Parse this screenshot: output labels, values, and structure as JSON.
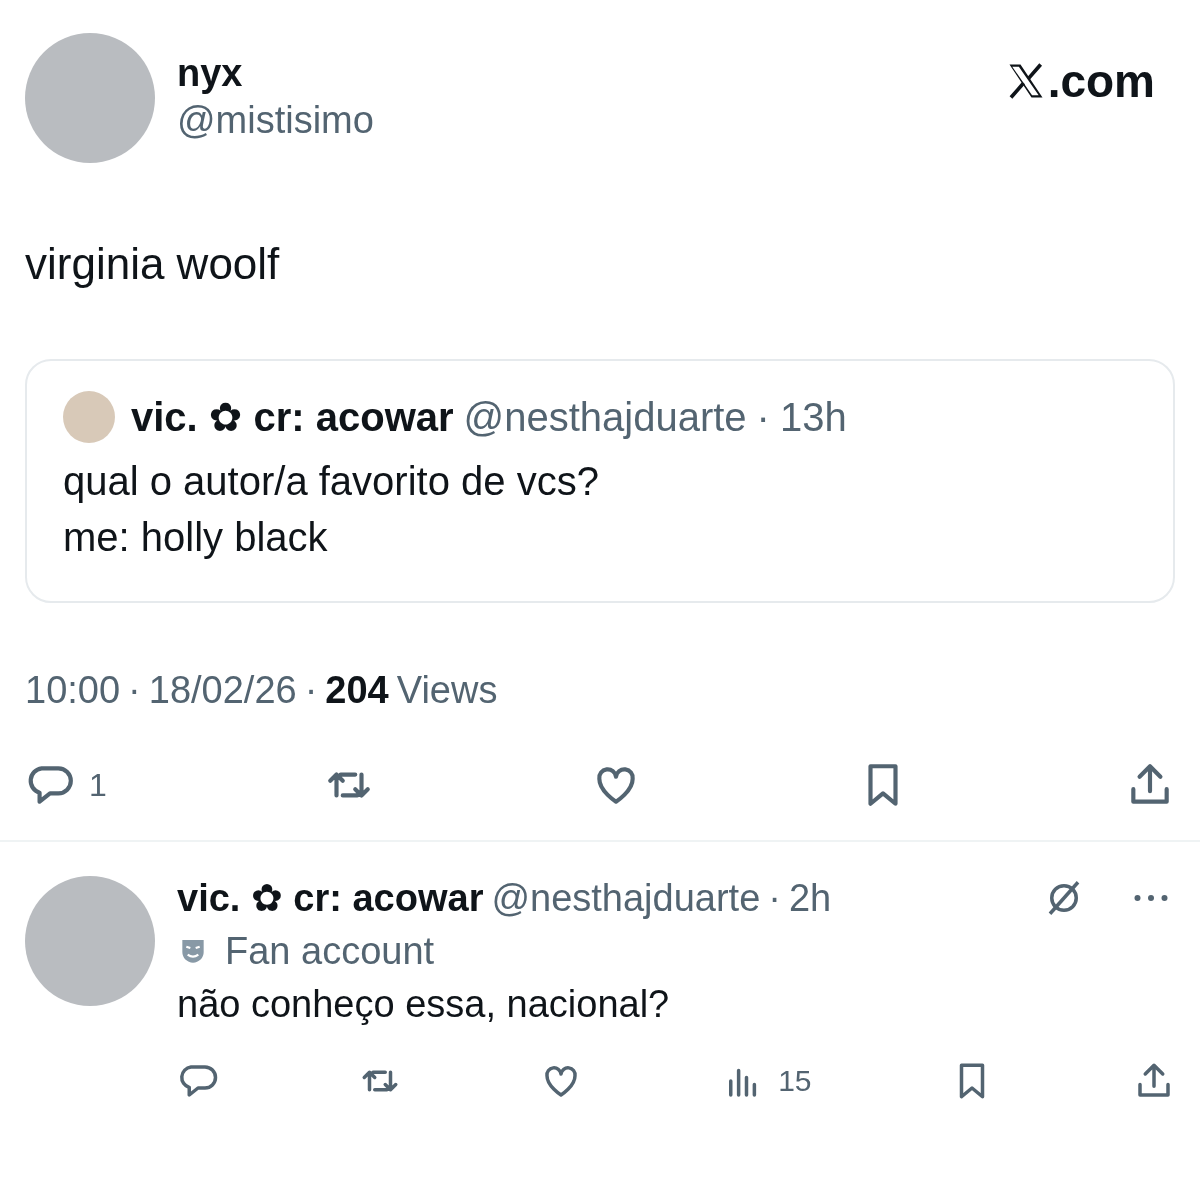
{
  "author": {
    "name": "nyx",
    "handle": "@mistisimo"
  },
  "logo": {
    "text": ".com"
  },
  "tweet_text": "virginia woolf",
  "quote": {
    "name": "vic. ✿ cr: acowar",
    "handle": "@nesthajduarte",
    "separator": "·",
    "time": "13h",
    "lines": [
      "qual o autor/a favorito de vcs?",
      "me: holly black"
    ]
  },
  "meta": {
    "time": "10:00",
    "separator_1": "·",
    "date": "18/02/26",
    "separator_2": "·",
    "views_count": "204",
    "views_label": "Views"
  },
  "actions": [
    {
      "kind": "reply",
      "count": "1"
    },
    {
      "kind": "retweet"
    },
    {
      "kind": "like"
    },
    {
      "kind": "bookmark"
    },
    {
      "kind": "share"
    }
  ],
  "reply": {
    "name": "vic. ✿ cr: acowar",
    "handle": "@nesthajduarte",
    "separator": "·",
    "time": "2h",
    "badge": "Fan account",
    "text": "não conheço essa, nacional?",
    "actions": [
      {
        "kind": "reply"
      },
      {
        "kind": "retweet"
      },
      {
        "kind": "like"
      },
      {
        "kind": "views",
        "count": "15"
      },
      {
        "kind": "bookmark"
      },
      {
        "kind": "share"
      }
    ]
  }
}
